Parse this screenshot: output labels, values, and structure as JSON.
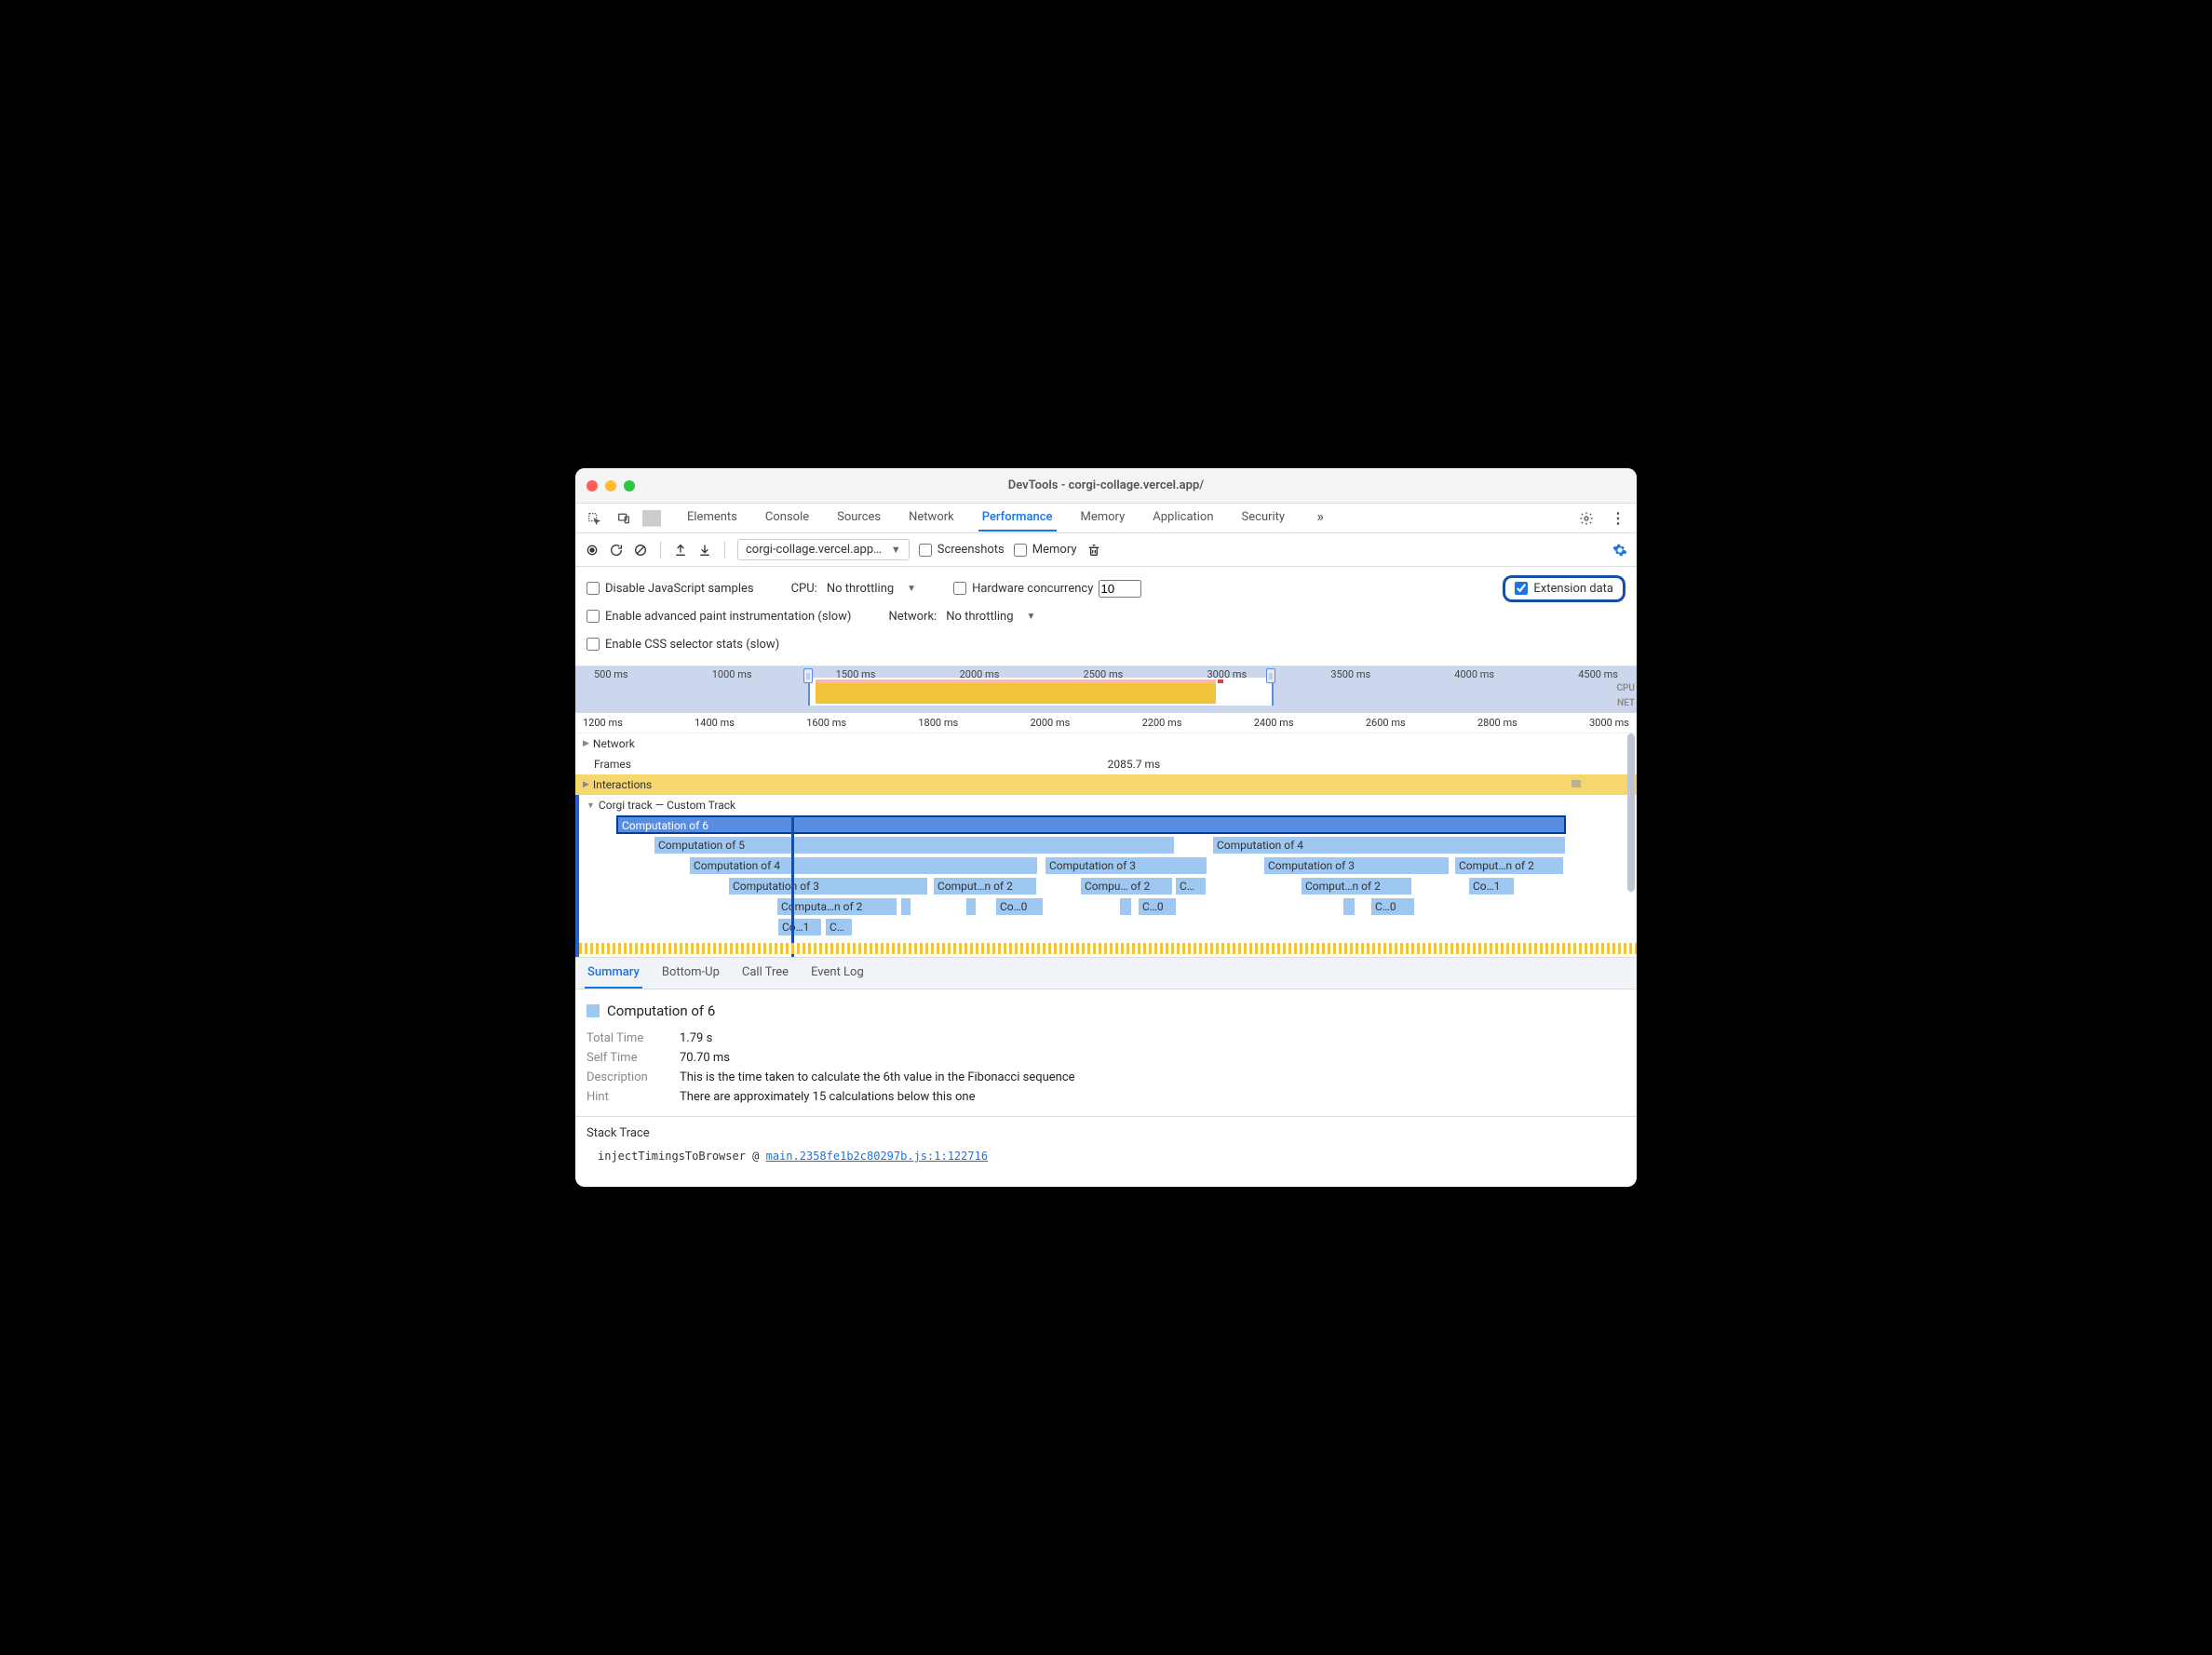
{
  "window": {
    "title": "DevTools - corgi-collage.vercel.app/"
  },
  "mainTabs": [
    "Elements",
    "Console",
    "Sources",
    "Network",
    "Performance",
    "Memory",
    "Application",
    "Security"
  ],
  "mainTabActive": "Performance",
  "perfToolbar": {
    "url": "corgi-collage.vercel.app…",
    "screenshots": "Screenshots",
    "memory": "Memory"
  },
  "settings": {
    "disableJS": "Disable JavaScript samples",
    "cpuLabel": "CPU:",
    "cpuValue": "No throttling",
    "hwLabel": "Hardware concurrency",
    "hwValue": "10",
    "extData": "Extension data",
    "advPaint": "Enable advanced paint instrumentation (slow)",
    "netLabel": "Network:",
    "netValue": "No throttling",
    "cssStats": "Enable CSS selector stats (slow)"
  },
  "overview": {
    "ticks": [
      "500 ms",
      "1000 ms",
      "1500 ms",
      "2000 ms",
      "2500 ms",
      "3000 ms",
      "3500 ms",
      "4000 ms",
      "4500 ms"
    ],
    "cpu": "CPU",
    "net": "NET"
  },
  "ruler": [
    "1200 ms",
    "1400 ms",
    "1600 ms",
    "1800 ms",
    "2000 ms",
    "2200 ms",
    "2400 ms",
    "2600 ms",
    "2800 ms",
    "3000 ms"
  ],
  "tracks": {
    "network": "Network",
    "frames": "Frames",
    "framesValue": "2085.7 ms",
    "interactions": "Interactions",
    "corgi": "Corgi track — Custom Track"
  },
  "flame": {
    "r0": "Computation of 6",
    "r1a": "Computation of 5",
    "r1b": "Computation of 4",
    "r2a": "Computation of 4",
    "r2b": "Computation of 3",
    "r2c": "Computation of 3",
    "r2d": "Comput…n of 2",
    "r3a": "Computation of 3",
    "r3b": "Comput…n of 2",
    "r3c": "Compu… of 2",
    "r3d": "C…",
    "r3e": "Comput…n of 2",
    "r3f": "Co…1",
    "r4a": "Computa…n of 2",
    "r4b": "Co…0",
    "r4c": "C…0",
    "r4d": "C…0",
    "r5a": "Co…1",
    "r5b": "C…"
  },
  "detailTabs": [
    "Summary",
    "Bottom-Up",
    "Call Tree",
    "Event Log"
  ],
  "detailActive": "Summary",
  "summary": {
    "title": "Computation of 6",
    "totalK": "Total Time",
    "totalV": "1.79 s",
    "selfK": "Self Time",
    "selfV": "70.70 ms",
    "descK": "Description",
    "descV": "This is the time taken to calculate the 6th value in the Fibonacci sequence",
    "hintK": "Hint",
    "hintV": "There are approximately 15 calculations below this one"
  },
  "stack": {
    "title": "Stack Trace",
    "fn": "injectTimingsToBrowser @ ",
    "link": "main.2358fe1b2c80297b.js:1:122716"
  }
}
